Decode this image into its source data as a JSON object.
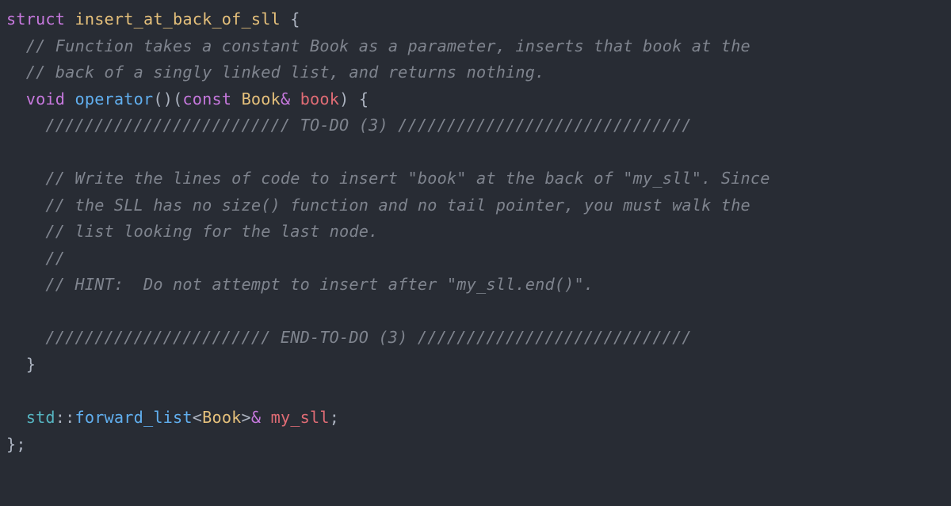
{
  "code": {
    "tokens": {
      "kw_struct": "struct",
      "kw_void": "void",
      "kw_const": "const",
      "type_struct": "insert_at_back_of_sll",
      "type_book": "Book",
      "fn_operator": "operator",
      "fn_forward_list": "forward_list",
      "ns_std": "std",
      "id_book": "book",
      "id_my_sll": "my_sll",
      "amp": "&",
      "open_brace": "{",
      "close_brace": "}",
      "open_paren": "(",
      "close_paren": ")",
      "open_angle": "<",
      "close_angle": ">",
      "double_colon": "::",
      "semi": ";",
      "close_struct": "};"
    },
    "comments": {
      "c1": "// Function takes a constant Book as a parameter, inserts that book at the",
      "c2": "// back of a singly linked list, and returns nothing.",
      "todo_open": "///////////////////////// TO-DO (3) //////////////////////////////",
      "c3": "// Write the lines of code to insert \"book\" at the back of \"my_sll\". Since",
      "c4": "// the SLL has no size() function and no tail pointer, you must walk the",
      "c5": "// list looking for the last node.",
      "c6": "//",
      "c7": "// HINT:  Do not attempt to insert after \"my_sll.end()\".",
      "todo_close": "/////////////////////// END-TO-DO (3) ////////////////////////////"
    }
  }
}
